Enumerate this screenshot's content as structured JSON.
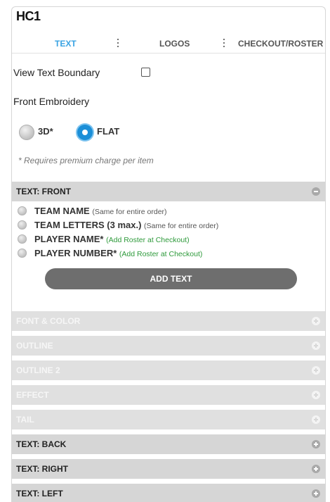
{
  "title": "HC1",
  "tabs": [
    {
      "label": "TEXT"
    },
    {
      "label": "LOGOS"
    },
    {
      "label": "CHECKOUT/ROSTER"
    }
  ],
  "view_text_boundary": {
    "label": "View Text Boundary",
    "checked": false
  },
  "embroidery": {
    "label": "Front Embroidery",
    "options": [
      {
        "label": "3D*",
        "selected": false
      },
      {
        "label": "FLAT",
        "selected": true
      }
    ],
    "note": "* Requires premium charge per item"
  },
  "text_front": {
    "header": "TEXT: FRONT",
    "options": [
      {
        "main": "TEAM NAME",
        "sub": "(Same for entire order)"
      },
      {
        "main": "TEAM LETTERS (3 max.)",
        "sub": "(Same for entire order)"
      },
      {
        "main": "PLAYER NAME*",
        "sub": "(Add Roster at Checkout)"
      },
      {
        "main": "PLAYER NUMBER*",
        "sub": "(Add Roster at Checkout)"
      }
    ],
    "add_button": "ADD TEXT"
  },
  "disabled_sections": [
    {
      "label": "FONT & COLOR"
    },
    {
      "label": "OUTLINE"
    },
    {
      "label": "OUTLINE 2"
    },
    {
      "label": "EFFECT"
    },
    {
      "label": "TAIL"
    }
  ],
  "other_sections": [
    {
      "label": "TEXT: BACK"
    },
    {
      "label": "TEXT: RIGHT"
    },
    {
      "label": "TEXT: LEFT"
    }
  ],
  "colors": {
    "accent": "#3aa3e3",
    "radio_selected": "#1b8fd8",
    "header_bg": "#d6d6d6",
    "disabled_header_bg": "#e0e0e0",
    "button_bg": "#6e6e6e",
    "green_note": "#2e9a3b"
  }
}
